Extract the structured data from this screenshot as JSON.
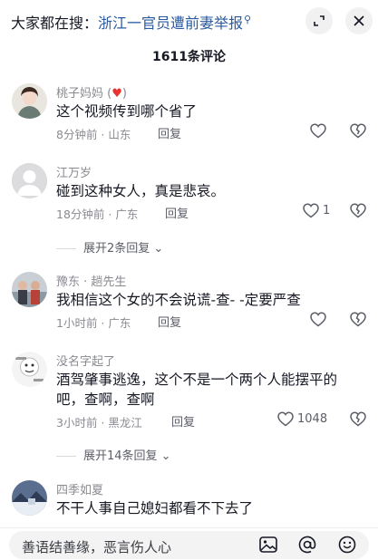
{
  "search": {
    "prefix": "大家都在搜：",
    "query": "浙江一官员遭前妻举报",
    "query_icon": "search-icon"
  },
  "header": {
    "comment_count_label": "1611条评论"
  },
  "comments": [
    {
      "user": "桃子妈妈 (",
      "user_suffix": ")",
      "user_emoji": "♥",
      "text": "这个视频传到哪个省了",
      "meta": "8分钟前 · 山东",
      "reply": "回复",
      "likes": ""
    },
    {
      "user": "江万岁",
      "text": "碰到这种女人，真是悲哀。",
      "meta": "18分钟前 · 广东",
      "reply": "回复",
      "likes": "1"
    },
    {
      "user": "豫东 · 趟先生",
      "text": "我相信这个女的不会说谎-查- -定要严查",
      "meta": "1小时前 · 广东",
      "reply": "回复",
      "likes": ""
    },
    {
      "user": "没名字起了",
      "text": "酒驾肇事逃逸，这个不是一个两个人能摆平的吧，查啊，查啊",
      "meta": "3小时前 · 黑龙江",
      "reply": "回复",
      "likes": "1048"
    },
    {
      "user": "四季如夏",
      "text": "不干人事自己媳妇都看不下去了"
    }
  ],
  "expand_rows": [
    {
      "label": "展开2条回复"
    },
    {
      "label": "展开14条回复"
    }
  ],
  "input": {
    "placeholder": "善语结善缘，恶言伤人心"
  },
  "colors": {
    "accent_link": "#2b5b9e",
    "heart": "#e8332f",
    "muted": "#8a8b91"
  }
}
